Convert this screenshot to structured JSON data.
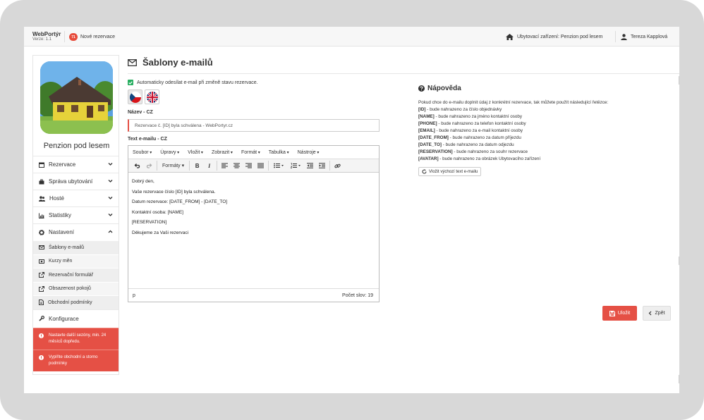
{
  "app": {
    "name": "WebPortýr",
    "version": "Verze: 1.1"
  },
  "topbar": {
    "notification_count": "71",
    "notification_label": "Nové rezervace",
    "facility": "Ubytovací zařízení: Penzion pod lesem",
    "user": "Tereza Kapplová"
  },
  "sidebar": {
    "property_name": "Penzion pod lesem",
    "menu": [
      {
        "label": "Rezervace",
        "icon": "calendar-icon"
      },
      {
        "label": "Správa ubytování",
        "icon": "briefcase-icon"
      },
      {
        "label": "Hosté",
        "icon": "users-icon"
      },
      {
        "label": "Statistiky",
        "icon": "bar-chart-icon"
      },
      {
        "label": "Nastavení",
        "icon": "gear-icon"
      }
    ],
    "submenu": [
      {
        "label": "Šablony e-mailů",
        "icon": "envelope-icon"
      },
      {
        "label": "Kurzy měn",
        "icon": "money-icon"
      },
      {
        "label": "Rezervační formulář",
        "icon": "external-link-icon"
      },
      {
        "label": "Obsazenost pokojů",
        "icon": "external-link-icon"
      },
      {
        "label": "Obchodní podmínky",
        "icon": "document-icon"
      }
    ],
    "config_label": "Konfigurace",
    "alerts": [
      "Nastavte další sezóny, min. 24 měsíců dopředu.",
      "Vyplňte obchodní a storno podmínky"
    ]
  },
  "page": {
    "title": "Šablony e-mailů",
    "auto_send_label": "Automaticky odesílat e-mail při změně stavu rezervace.",
    "auto_send_checked": true,
    "name_label": "Název - CZ",
    "name_value": "Rezervace č. [ID] byla schválena - WebPortyr.cz",
    "text_label": "Text e-mailu - CZ"
  },
  "editor": {
    "menu": [
      "Soubor",
      "Úpravy",
      "Vložit",
      "Zobrazit",
      "Formát",
      "Tabulka",
      "Nástroje"
    ],
    "formats_label": "Formáty",
    "body": [
      "Dobrý den,",
      "Vaše rezervace číslo [ID] byla schválena.",
      "Datum rezervace: [DATE_FROM] - [DATE_TO]",
      "Kontaktní osoba: [NAME]",
      "[RESERVATION]",
      "Děkujeme za Vaši rezervaci"
    ],
    "status_path": "p",
    "word_count": "Počet slov: 19"
  },
  "help": {
    "title": "Nápověda",
    "intro": "Pokud chce do e-mailu doplnit údaj z konkrétní rezervace, tak můžete použít následující řetězce:",
    "items": [
      {
        "key": "[ID]",
        "desc": " - bude nahrazeno za číslo objednávky"
      },
      {
        "key": "[NAME]",
        "desc": " - bude nahrazeno za jméno kontaktní osoby"
      },
      {
        "key": "[PHONE]",
        "desc": " - bude nahrazeno za telefon kontaktní osoby"
      },
      {
        "key": "[EMAIL]",
        "desc": " - bude nahrazeno za e-mail kontaktní osoby"
      },
      {
        "key": "[DATE_FROM]",
        "desc": " - bude nahrazeno za datum příjezdu"
      },
      {
        "key": "[DATE_TO]",
        "desc": " - bude nahrazeno za datum odjezdu"
      },
      {
        "key": "[RESERVATION]",
        "desc": " - bude nahrazeno za souhr rezervace"
      },
      {
        "key": "[AVATAR]",
        "desc": " - bude nahrazeno za obrázek Ubytovacího zařízení"
      }
    ],
    "default_button": "Vložit výchozí text e-mailu"
  },
  "actions": {
    "save": "Uložit",
    "back": "Zpět"
  },
  "colors": {
    "accent": "#e55045",
    "check": "#27ae60",
    "badge": "#e74c3c"
  }
}
